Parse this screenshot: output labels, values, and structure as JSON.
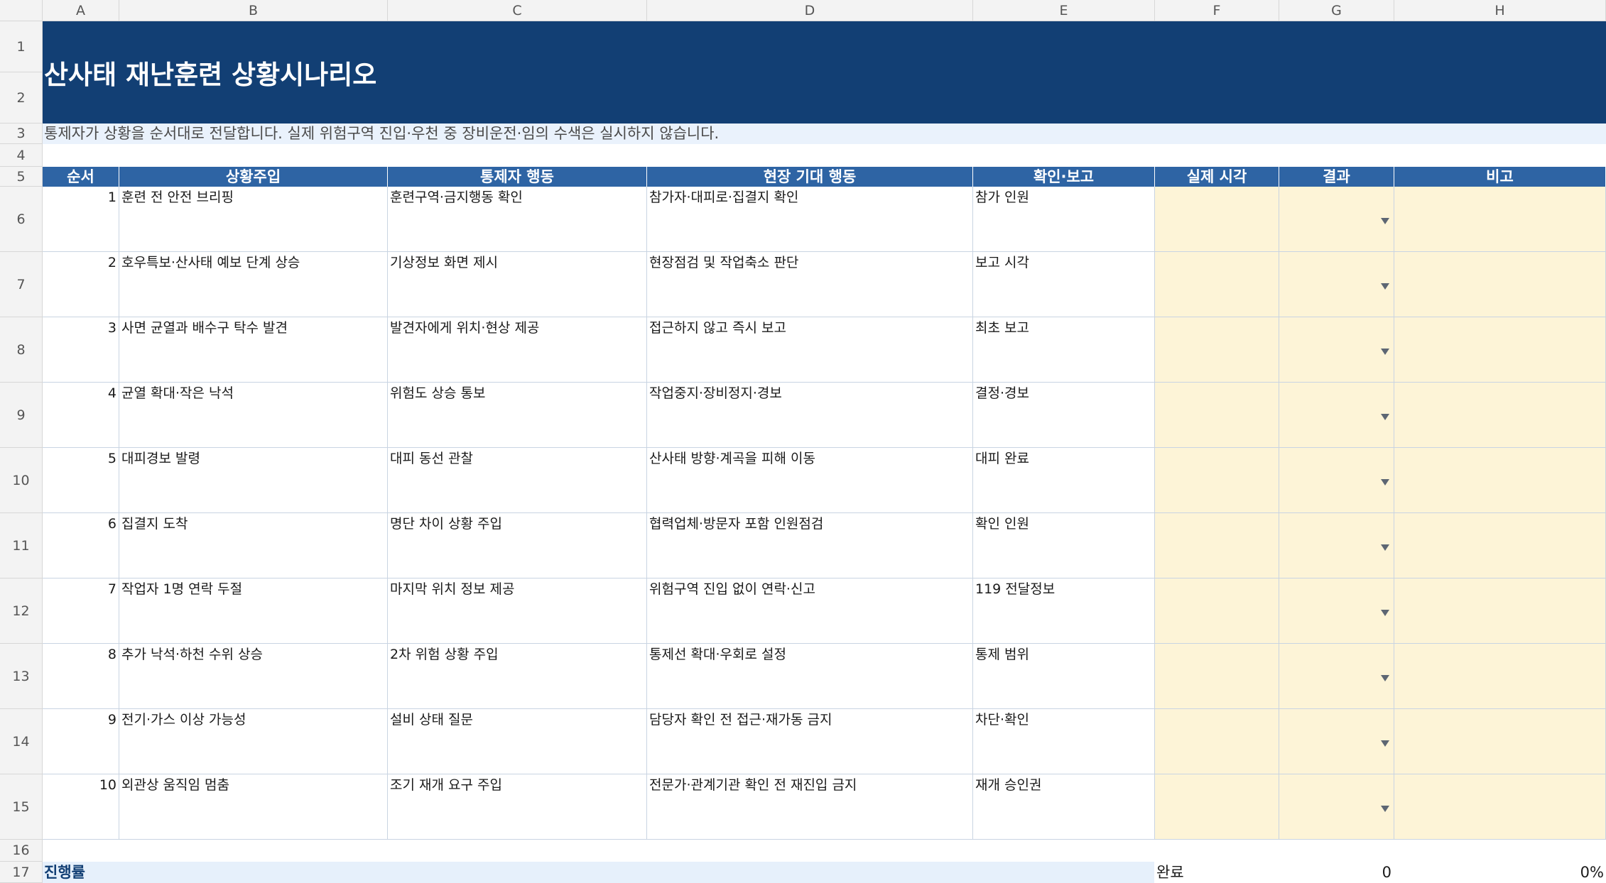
{
  "columns": [
    "A",
    "B",
    "C",
    "D",
    "E",
    "F",
    "G",
    "H"
  ],
  "row_numbers": [
    "1",
    "2",
    "3",
    "4",
    "5",
    "6",
    "7",
    "8",
    "9",
    "10",
    "11",
    "12",
    "13",
    "14",
    "15",
    "16",
    "17"
  ],
  "title": "산사태 재난훈련 상황시나리오",
  "note": "통제자가 상황을 순서대로 전달합니다. 실제 위험구역 진입·우천 중 장비운전·임의 수색은 실시하지 않습니다.",
  "headers": [
    "순서",
    "상황주입",
    "통제자 행동",
    "현장 기대 행동",
    "확인·보고",
    "실제 시각",
    "결과",
    "비고"
  ],
  "rows": [
    {
      "no": "1",
      "situation": "훈련 전 안전 브리핑",
      "controller": "훈련구역·금지행동 확인",
      "expected": "참가자·대피로·집결지 확인",
      "report": "참가 인원"
    },
    {
      "no": "2",
      "situation": "호우특보·산사태 예보 단계 상승",
      "controller": "기상정보 화면 제시",
      "expected": "현장점검 및 작업축소 판단",
      "report": "보고 시각"
    },
    {
      "no": "3",
      "situation": "사면 균열과 배수구 탁수 발견",
      "controller": "발견자에게 위치·현상 제공",
      "expected": "접근하지 않고 즉시 보고",
      "report": "최초 보고"
    },
    {
      "no": "4",
      "situation": "균열 확대·작은 낙석",
      "controller": "위험도 상승 통보",
      "expected": "작업중지·장비정지·경보",
      "report": "결정·경보"
    },
    {
      "no": "5",
      "situation": "대피경보 발령",
      "controller": "대피 동선 관찰",
      "expected": "산사태 방향·계곡을 피해 이동",
      "report": "대피 완료"
    },
    {
      "no": "6",
      "situation": "집결지 도착",
      "controller": "명단 차이 상황 주입",
      "expected": "협력업체·방문자 포함 인원점검",
      "report": "확인 인원"
    },
    {
      "no": "7",
      "situation": "작업자 1명 연락 두절",
      "controller": "마지막 위치 정보 제공",
      "expected": "위험구역 진입 없이 연락·신고",
      "report": "119 전달정보"
    },
    {
      "no": "8",
      "situation": "추가 낙석·하천 수위 상승",
      "controller": "2차 위험 상황 주입",
      "expected": "통제선 확대·우회로 설정",
      "report": "통제 범위"
    },
    {
      "no": "9",
      "situation": "전기·가스 이상 가능성",
      "controller": "설비 상태 질문",
      "expected": "담당자 확인 전 접근·재가동 금지",
      "report": "차단·확인"
    },
    {
      "no": "10",
      "situation": "외관상 움직임 멈춤",
      "controller": "조기 재개 요구 주입",
      "expected": "전문가·관계기관 확인 전 재진입 금지",
      "report": "재개 승인권"
    }
  ],
  "progress": {
    "label": "진행률",
    "done_label": "완료",
    "done_count": "0",
    "percent": "0%"
  },
  "colors": {
    "title_bg": "#123f74",
    "header_bg": "#2e64a4",
    "input_bg": "#fdf4d7",
    "note_bg": "#eaf2fc"
  }
}
